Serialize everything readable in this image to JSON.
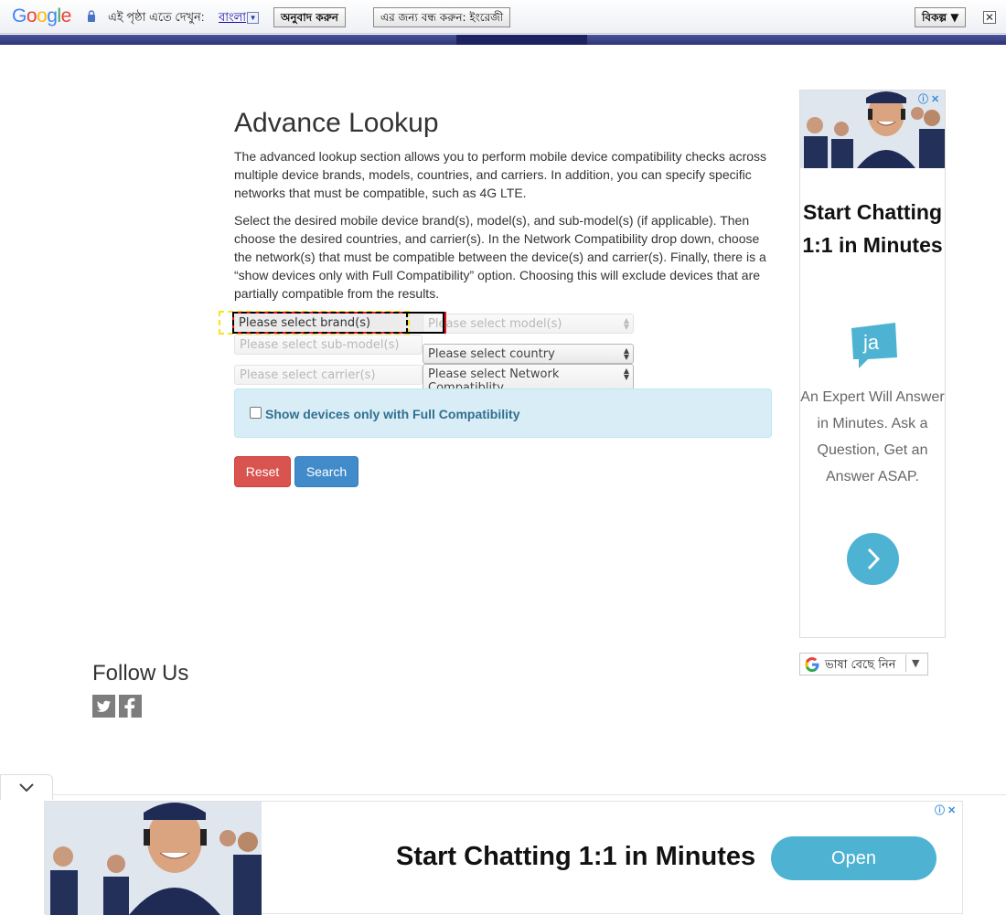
{
  "translate_bar": {
    "logo": [
      "G",
      "o",
      "o",
      "g",
      "l",
      "e"
    ],
    "logo_colors": [
      "#4285f4",
      "#ea4335",
      "#fbbc05",
      "#4285f4",
      "#34a853",
      "#ea4335"
    ],
    "message": "এই পৃষ্ঠা এতে দেখুন:",
    "language": "বাংলা",
    "translate_button": "অনুবাদ করুন",
    "never_button": "এর জন্য বন্ধ করুন: ইংরেজী",
    "options_button": "বিকল্প ▼",
    "close": "✕"
  },
  "main": {
    "title": "Advance Lookup",
    "paragraph1": "The advanced lookup section allows you to perform mobile device compatibility checks across multiple device brands, models, countries, and carriers. In addition, you can specify specific networks that must be compatible, such as 4G LTE.",
    "paragraph2": "Select the desired mobile device brand(s), model(s), and sub-model(s) (if applicable). Then choose the desired countries, and carrier(s). In the Network Compatibility drop down, choose the network(s) that must be compatible between the device(s) and carrier(s). Finally, there is a “show devices only with Full Compatibility” option. Choosing this will exclude devices that are partially compatible from the results.",
    "selects": {
      "brand": "Please select brand(s)",
      "model": "Please select model(s)",
      "submodel": "Please select sub-model(s)",
      "country": "Please select country",
      "carrier": "Please select carrier(s)",
      "network": "Please select Network Compatiblity"
    },
    "full_compat_label": "Show devices only with Full Compatibility",
    "reset_button": "Reset",
    "search_button": "Search"
  },
  "ad_right": {
    "headline": "Start Chatting 1:1 in Minutes",
    "logo_text": "ja",
    "description": "An Expert Will Answer in Minutes. Ask a Question, Get an Answer ASAP."
  },
  "language_picker": {
    "label": "ভাষা বেছে নিন"
  },
  "footer": {
    "follow_title": "Follow Us",
    "social": [
      "twitter-icon",
      "facebook-icon"
    ]
  },
  "ad_bottom": {
    "headline": "Start Chatting 1:1 in Minutes",
    "open_button": "Open"
  }
}
